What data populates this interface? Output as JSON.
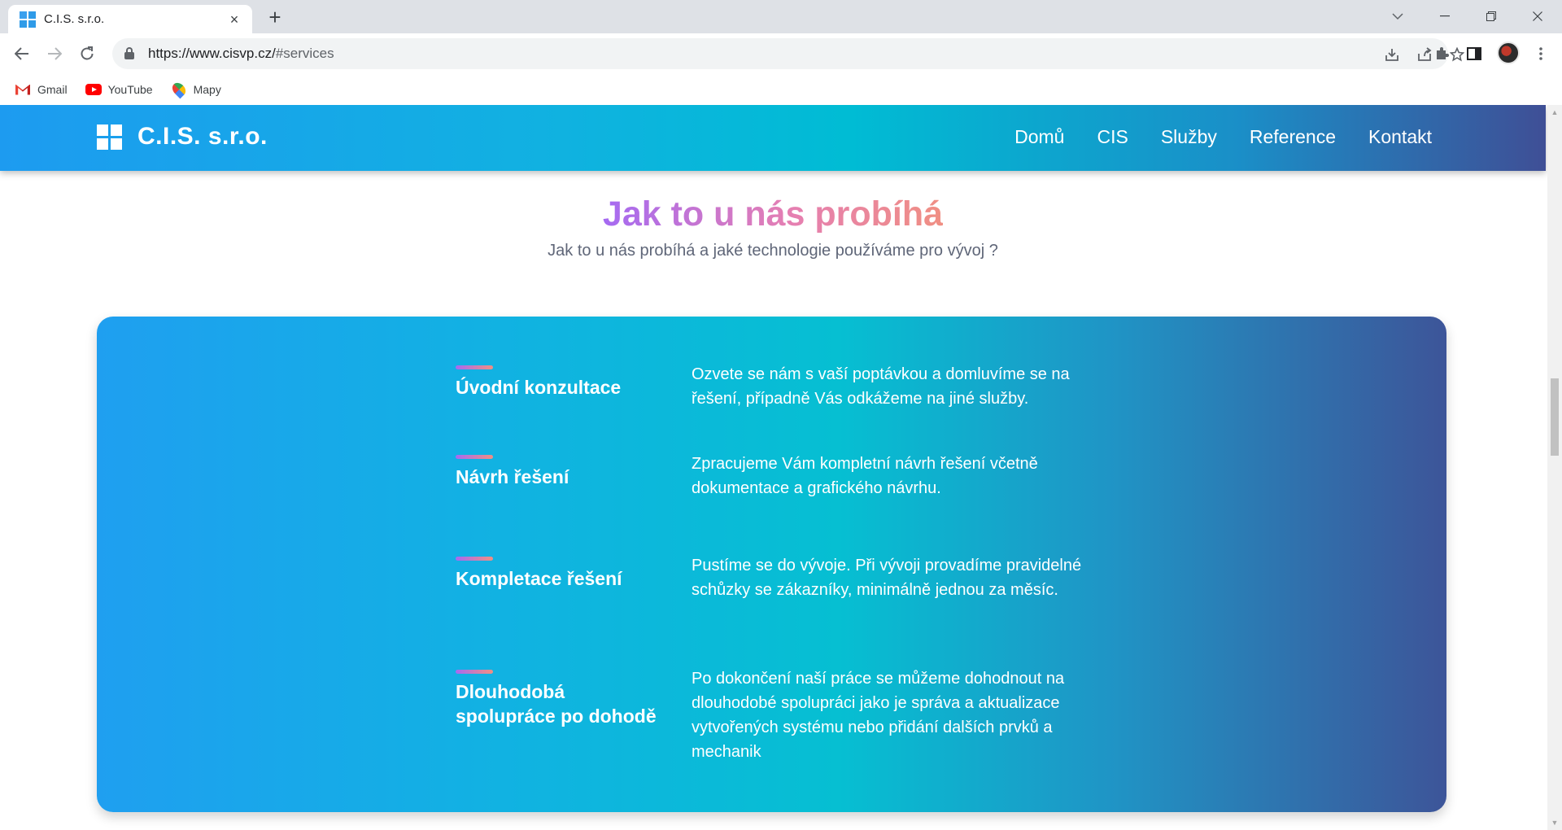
{
  "browser": {
    "tab_title": "C.I.S. s.r.o.",
    "tab_close": "×",
    "new_tab": "+",
    "url_host": "https://www.cisvp.cz/",
    "url_fragment": "#services",
    "bookmarks": [
      {
        "label": "Gmail",
        "icon": "gmail-icon"
      },
      {
        "label": "YouTube",
        "icon": "youtube-icon"
      },
      {
        "label": "Mapy",
        "icon": "maps-icon"
      }
    ]
  },
  "site": {
    "logo_text": "C.I.S. s.r.o.",
    "nav": [
      "Domů",
      "CIS",
      "Služby",
      "Reference",
      "Kontakt"
    ]
  },
  "section": {
    "title": "Jak to u nás probíhá",
    "subtitle": "Jak to u nás probíhá a jaké technologie používáme pro vývoj ?"
  },
  "steps": [
    {
      "title": "Úvodní konzultace",
      "text": "Ozvete se nám s vaší poptávkou a domluvíme se na řešení, případně Vás odkážeme na jiné služby."
    },
    {
      "title": "Návrh řešení",
      "text": "Zpracujeme Vám kompletní návrh řešení včetně dokumentace a grafického návrhu."
    },
    {
      "title": "Kompletace řešení",
      "text": "Pustíme se do vývoje. Při vývoji provadíme pravidelné schůzky se zákazníky, minimálně jednou za měsíc."
    },
    {
      "title": "Dlouhodobá spolupráce po dohodě",
      "text": "Po dokončení naší práce se můžeme dohodnout na dlouhodobé spolupráci jako je správa a aktualizace vytvořených systému nebo přidání dalších prvků a mechanik"
    }
  ],
  "colors": {
    "header_gradient_start": "#1d9bf0",
    "header_gradient_end": "#3f4f96",
    "title_gradient_start": "#a56af2",
    "title_gradient_end": "#f08f83"
  }
}
